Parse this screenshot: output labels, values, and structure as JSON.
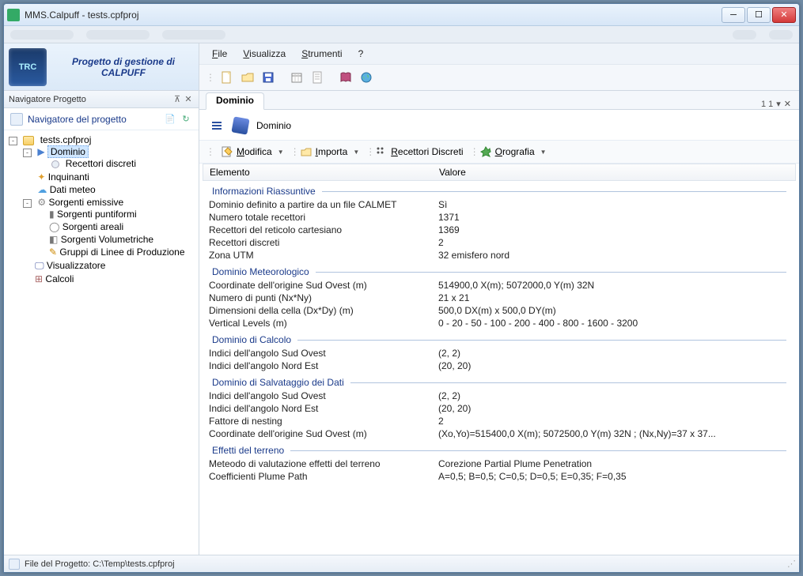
{
  "window": {
    "title": "MMS.Calpuff - tests.cpfproj"
  },
  "brand": {
    "logo": "TRC",
    "line1": "Progetto di gestione di",
    "line2": "CALPUFF"
  },
  "menu": {
    "file": "File",
    "visualizza": "Visualizza",
    "strumenti": "Strumenti",
    "help": "?"
  },
  "sidebar": {
    "panel_title": "Navigatore Progetto",
    "subheader": "Navigatore del progetto",
    "tree": {
      "root": "tests.cpfproj",
      "n0": "Dominio",
      "n0_0": "Recettori discreti",
      "n1": "Inquinanti",
      "n2": "Dati meteo",
      "n3": "Sorgenti emissive",
      "n3_0": "Sorgenti puntiformi",
      "n3_1": "Sorgenti areali",
      "n3_2": "Sorgenti Volumetriche",
      "n3_3": "Gruppi di Linee di Produzione",
      "n4": "Visualizzatore",
      "n5": "Calcoli"
    }
  },
  "tab": {
    "label": "Dominio",
    "counter": "1 1"
  },
  "page": {
    "title": "Dominio",
    "toolbar": {
      "modifica": "Modifica",
      "importa": "Importa",
      "recettori": "Recettori Discreti",
      "orografia": "Orografia"
    },
    "columns": {
      "a": "Elemento",
      "b": "Valore"
    },
    "sec1": "Informazioni Riassuntive",
    "r1a": "Dominio definito a partire da un file CALMET",
    "r1b": "Sì",
    "r2a": "Numero totale recettori",
    "r2b": "1371",
    "r3a": "Recettori del reticolo cartesiano",
    "r3b": "1369",
    "r4a": "Recettori discreti",
    "r4b": "2",
    "r5a": "Zona UTM",
    "r5b": "32 emisfero nord",
    "sec2": "Dominio Meteorologico",
    "r6a": "Coordinate dell'origine Sud Ovest (m)",
    "r6b": "514900,0 X(m); 5072000,0 Y(m) 32N",
    "r7a": "Numero di punti (Nx*Ny)",
    "r7b": "21 x 21",
    "r8a": "Dimensioni della cella (Dx*Dy) (m)",
    "r8b": "500,0 DX(m) x 500,0 DY(m)",
    "r9a": "Vertical Levels (m)",
    "r9b": "0 - 20 - 50 - 100 - 200 - 400 - 800 - 1600 - 3200",
    "sec3": "Dominio di Calcolo",
    "r10a": "Indici dell'angolo Sud Ovest",
    "r10b": "(2, 2)",
    "r11a": "Indici dell'angolo Nord Est",
    "r11b": "(20, 20)",
    "sec4": "Dominio di Salvataggio dei Dati",
    "r12a": "Indici dell'angolo Sud Ovest",
    "r12b": "(2, 2)",
    "r13a": "Indici dell'angolo Nord Est",
    "r13b": "(20, 20)",
    "r14a": "Fattore di nesting",
    "r14b": "2",
    "r15a": "Coordinate dell'origine Sud Ovest (m)",
    "r15b": "(Xo,Yo)=515400,0 X(m); 5072500,0 Y(m) 32N ; (Nx,Ny)=37 x 37...",
    "sec5": "Effetti del terreno",
    "r16a": "Meteodo di valutazione effetti del terreno",
    "r16b": "Corezione Partial Plume Penetration",
    "r17a": "Coefficienti Plume Path",
    "r17b": "A=0,5; B=0,5; C=0,5; D=0,5; E=0,35; F=0,35"
  },
  "status": {
    "label": "File del Progetto:  C:\\Temp\\tests.cpfproj"
  }
}
